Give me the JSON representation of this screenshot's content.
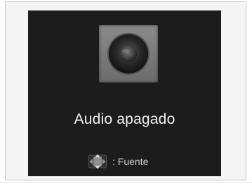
{
  "screen": {
    "status_text": "Audio apagado",
    "hint_label": ": Fuente",
    "speaker_icon": "speaker-icon",
    "hint_icon": "selector-knob-icon"
  },
  "colors": {
    "screen_background": "#1c1c1c",
    "frame_background": "#f4f4f4",
    "status_text": "#f2f2f2",
    "hint_text": "#cfcfcf"
  }
}
